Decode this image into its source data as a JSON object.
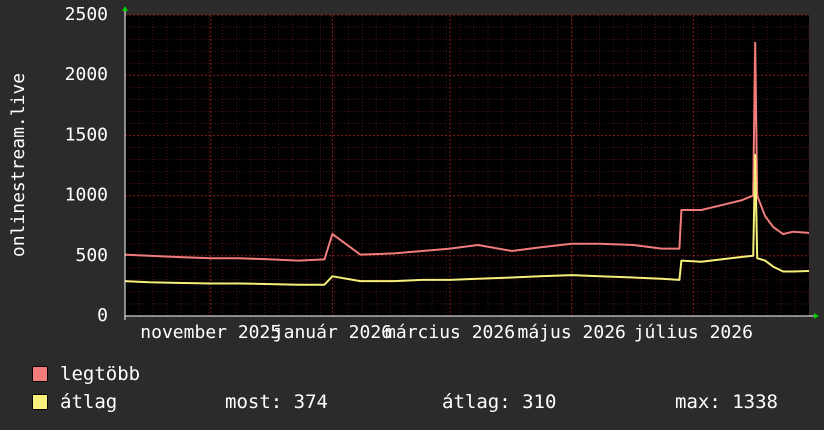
{
  "chart_data": {
    "type": "line",
    "ylabel": "onlinestream.live",
    "ylim": [
      0,
      2500
    ],
    "yticks": [
      0,
      500,
      1000,
      1500,
      2000,
      2500
    ],
    "x_range": [
      "2025-09-19",
      "2026-08-28"
    ],
    "xtick_labels": [
      {
        "date": "2025-11-01",
        "label": "november 2025"
      },
      {
        "date": "2026-01-01",
        "label": "január 2026"
      },
      {
        "date": "2026-03-01",
        "label": "március 2026"
      },
      {
        "date": "2026-05-01",
        "label": "május 2026"
      },
      {
        "date": "2026-07-01",
        "label": "július 2026"
      }
    ],
    "grid": true,
    "series": [
      {
        "name": "legtöbb",
        "color": "#f07c7c",
        "points": [
          [
            "2025-09-19",
            510
          ],
          [
            "2025-10-01",
            500
          ],
          [
            "2025-10-15",
            490
          ],
          [
            "2025-11-01",
            480
          ],
          [
            "2025-11-15",
            480
          ],
          [
            "2025-12-01",
            470
          ],
          [
            "2025-12-15",
            460
          ],
          [
            "2025-12-28",
            470
          ],
          [
            "2026-01-01",
            680
          ],
          [
            "2026-01-15",
            510
          ],
          [
            "2026-02-01",
            520
          ],
          [
            "2026-02-15",
            540
          ],
          [
            "2026-03-01",
            560
          ],
          [
            "2026-03-15",
            590
          ],
          [
            "2026-04-01",
            540
          ],
          [
            "2026-04-15",
            570
          ],
          [
            "2026-05-01",
            600
          ],
          [
            "2026-05-15",
            600
          ],
          [
            "2026-06-01",
            590
          ],
          [
            "2026-06-15",
            560
          ],
          [
            "2026-06-24",
            560
          ],
          [
            "2026-06-25",
            880
          ],
          [
            "2026-07-05",
            880
          ],
          [
            "2026-07-15",
            920
          ],
          [
            "2026-07-25",
            960
          ],
          [
            "2026-07-31",
            1000
          ],
          [
            "2026-08-01",
            2270
          ],
          [
            "2026-08-02",
            1000
          ],
          [
            "2026-08-06",
            830
          ],
          [
            "2026-08-10",
            740
          ],
          [
            "2026-08-15",
            680
          ],
          [
            "2026-08-20",
            700
          ],
          [
            "2026-08-28",
            690
          ]
        ]
      },
      {
        "name": "átlag",
        "color": "#f5f07a",
        "points": [
          [
            "2025-09-19",
            290
          ],
          [
            "2025-10-01",
            280
          ],
          [
            "2025-10-15",
            275
          ],
          [
            "2025-11-01",
            270
          ],
          [
            "2025-11-15",
            270
          ],
          [
            "2025-12-01",
            265
          ],
          [
            "2025-12-15",
            260
          ],
          [
            "2025-12-28",
            260
          ],
          [
            "2026-01-01",
            330
          ],
          [
            "2026-01-15",
            290
          ],
          [
            "2026-02-01",
            290
          ],
          [
            "2026-02-15",
            300
          ],
          [
            "2026-03-01",
            300
          ],
          [
            "2026-03-15",
            310
          ],
          [
            "2026-04-01",
            320
          ],
          [
            "2026-04-15",
            330
          ],
          [
            "2026-05-01",
            340
          ],
          [
            "2026-05-15",
            330
          ],
          [
            "2026-06-01",
            320
          ],
          [
            "2026-06-15",
            310
          ],
          [
            "2026-06-24",
            300
          ],
          [
            "2026-06-25",
            460
          ],
          [
            "2026-07-05",
            450
          ],
          [
            "2026-07-15",
            470
          ],
          [
            "2026-07-25",
            490
          ],
          [
            "2026-07-31",
            500
          ],
          [
            "2026-08-01",
            1338
          ],
          [
            "2026-08-02",
            480
          ],
          [
            "2026-08-06",
            460
          ],
          [
            "2026-08-10",
            410
          ],
          [
            "2026-08-15",
            370
          ],
          [
            "2026-08-20",
            370
          ],
          [
            "2026-08-28",
            374
          ]
        ]
      }
    ]
  },
  "legend": {
    "max_label": "legtöbb",
    "avg_label": "átlag"
  },
  "stats": {
    "now": "most: 374",
    "avg": "átlag: 310",
    "max": "max: 1338"
  },
  "colors": {
    "background": "#2b2b2b",
    "plot_background": "#000000",
    "grid_major": "#8b1a1a",
    "grid_minor": "#4a1414",
    "axis": "#ffffff",
    "arrow": "#00cc00"
  }
}
